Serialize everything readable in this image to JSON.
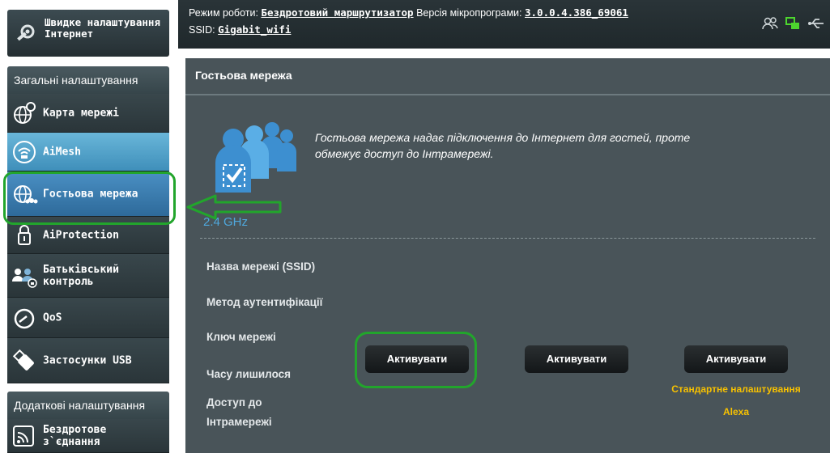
{
  "quick_setup": {
    "label": "Швидке налаштування Інтернет",
    "icon": "wrench-gear-icon"
  },
  "sidebar": {
    "general_header": "Загальні налаштування",
    "items": [
      {
        "label": "Карта мережі",
        "icon": "network-globe-icon"
      },
      {
        "label": "AiMesh",
        "icon": "aimesh-router-icon"
      },
      {
        "label": "Гостьова мережа",
        "icon": "guest-network-icon"
      },
      {
        "label": "AiProtection",
        "icon": "padlock-icon"
      },
      {
        "label": "Батьківський контроль",
        "icon": "parental-control-icon"
      },
      {
        "label": "QoS",
        "icon": "speedometer-icon"
      },
      {
        "label": "Застосунки USB",
        "icon": "usb-icon"
      }
    ],
    "advanced_header": "Додаткові налаштування",
    "advanced_items": [
      {
        "label": "Бездротове з`єднання",
        "icon": "wireless-signal-icon"
      }
    ]
  },
  "topbar": {
    "mode_label": "Режим роботи:",
    "mode_value": "Бездротовий маршрутизатор",
    "firmware_label": "Версія мікропрограми:",
    "firmware_value": "3.0.0.4.386_69061",
    "ssid_label": "SSID:",
    "ssid_value": "Gigabit_wifi",
    "icons": [
      "users-icon",
      "lan-status-icon",
      "usb-status-icon"
    ],
    "colors": {
      "lan_status": "#4dd62e"
    }
  },
  "main": {
    "title": "Гостьова мережа",
    "description": "Гостьова мережа надає підключення до Інтернет для гостей, проте обмежує доступ до Інтрамережі.",
    "band": "2.4 GHz",
    "fields": [
      "Назва мережі (SSID)",
      "Метод аутентифікації",
      "Ключ мережі",
      "Часу лишилося",
      "Доступ до Інтрамережі"
    ],
    "buttons": [
      "Активувати",
      "Активувати",
      "Активувати"
    ],
    "links": [
      "Стандартне налаштування",
      "Alexa"
    ],
    "colors": {
      "band_label": "#4fa8dd",
      "link": "#f7c100",
      "panel_bg": "#495459"
    }
  }
}
